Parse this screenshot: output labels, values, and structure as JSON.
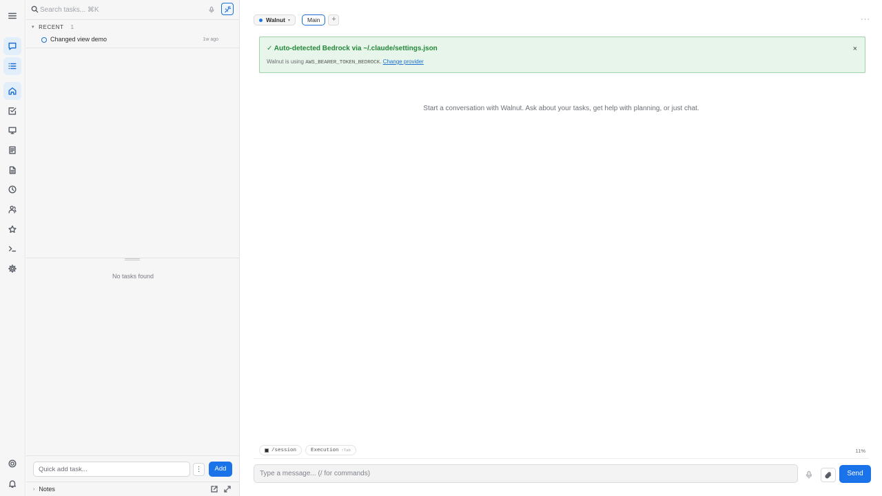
{
  "search": {
    "placeholder": "Search tasks... ⌘K"
  },
  "rail": {
    "icons": [
      "chat-icon",
      "list-icon",
      "home-icon",
      "task-check-icon",
      "monitor-icon",
      "document-icon",
      "file-icon",
      "clock-icon",
      "people-icon",
      "star-icon",
      "terminal-icon",
      "settings-icon",
      "help-icon",
      "bell-icon"
    ]
  },
  "recent": {
    "label": "RECENT",
    "count": "1",
    "items": [
      {
        "title": "Changed view demo",
        "time": "1w ago"
      }
    ]
  },
  "tasks": {
    "empty_text": "No tasks found"
  },
  "quick_add": {
    "placeholder": "Quick add task...",
    "more_label": "⋮",
    "add_label": "Add"
  },
  "notes": {
    "label": "Notes"
  },
  "tabs": {
    "workspace": "Walnut",
    "active_tab": "Main",
    "add_label": "+"
  },
  "more_menu": "···",
  "banner": {
    "title": "✓ Auto-detected Bedrock via ~/.claude/settings.json",
    "body_prefix": "Walnut is using",
    "env_var": "AWS_BEARER_TOKEN_BEDROCK",
    "body_suffix": ".",
    "link_label": "Change provider",
    "close_label": "×"
  },
  "chat": {
    "empty_hint": "Start a conversation with Walnut. Ask about your tasks, get help with planning, or just chat."
  },
  "chips": [
    {
      "label": "/session",
      "sub": ""
    },
    {
      "label": "Execution",
      "sub": "⇧Tab"
    }
  ],
  "context_usage": "11%",
  "composer": {
    "placeholder": "Type a message... (/ for commands)",
    "send_label": "Send"
  },
  "colors": {
    "accent": "#1a73e8",
    "banner_bg": "#e8f5ea",
    "banner_text": "#23883a"
  }
}
